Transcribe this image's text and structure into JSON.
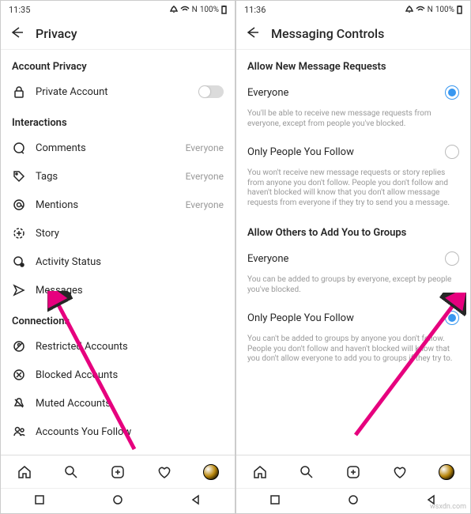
{
  "left": {
    "status": {
      "time": "11:35",
      "battery": "100%"
    },
    "header": {
      "title": "Privacy"
    },
    "sections": {
      "accountPrivacy": {
        "title": "Account Privacy",
        "privateAccount": "Private Account"
      },
      "interactions": {
        "title": "Interactions",
        "comments": {
          "label": "Comments",
          "value": "Everyone"
        },
        "tags": {
          "label": "Tags",
          "value": "Everyone"
        },
        "mentions": {
          "label": "Mentions",
          "value": "Everyone"
        },
        "story": "Story",
        "activityStatus": "Activity Status",
        "messages": "Messages"
      },
      "connections": {
        "title": "Connections",
        "restricted": "Restricted Accounts",
        "blocked": "Blocked Accounts",
        "muted": "Muted Accounts",
        "following": "Accounts You Follow"
      }
    }
  },
  "right": {
    "status": {
      "time": "11:36",
      "battery": "100%"
    },
    "header": {
      "title": "Messaging Controls"
    },
    "allowNew": {
      "title": "Allow New Message Requests",
      "opt1": "Everyone",
      "hint1": "You'll be able to receive new message requests from everyone, except from people you've blocked.",
      "opt2": "Only People You Follow",
      "hint2": "You won't receive new message requests or story replies from anyone you don't follow. People you don't follow and haven't blocked will know that you don't allow message requests from everyone if they try to send you a message."
    },
    "allowGroups": {
      "title": "Allow Others to Add You to Groups",
      "opt1": "Everyone",
      "hint1": "You can be added to groups by everyone, except by people you've blocked.",
      "opt2": "Only People You Follow",
      "hint2": "You can't be added to groups by anyone you don't follow. People you don't follow and haven't blocked will know that you don't allow everyone to add you to groups if they try to."
    }
  },
  "watermark": "wsxdn.com"
}
